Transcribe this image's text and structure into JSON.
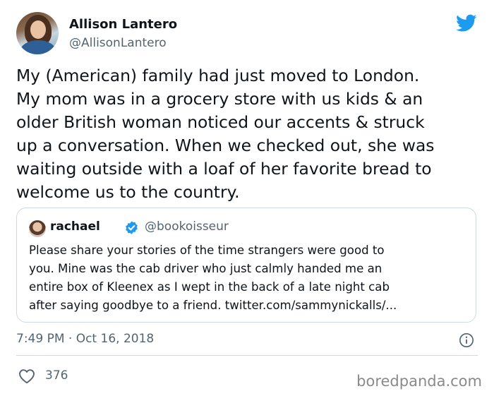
{
  "author": {
    "display_name": "Allison Lantero",
    "handle": "@AllisonLantero"
  },
  "tweet": {
    "text_lines": [
      "My (American) family had just moved to London.",
      "My mom was in a grocery store with us kids & an",
      "older British woman noticed our accents & struck",
      "up a conversation. When we checked out, she was",
      "waiting outside with a loaf of her favorite bread to",
      "welcome us to the country."
    ],
    "timestamp": "7:49 PM · Oct 16, 2018",
    "like_count": "376"
  },
  "quoted_tweet": {
    "display_name": "rachael",
    "handle": "@bookoisseur",
    "verified": true,
    "text_lines": [
      "Please share your stories of the time strangers were good to",
      "you. Mine was the cab driver who just calmly handed me an",
      "entire box of Kleenex as I wept in the back of a late night cab",
      "after saying goodbye to a friend. twitter.com/sammynickalls/..."
    ]
  },
  "watermark": "boredpanda.com",
  "colors": {
    "twitter_blue": "#1d9bf0",
    "secondary_text": "#536471",
    "border": "#cfd9de"
  },
  "icons": {
    "brand": "twitter-bird-icon",
    "verified": "verified-badge-icon",
    "info": "info-icon",
    "like": "heart-icon"
  }
}
